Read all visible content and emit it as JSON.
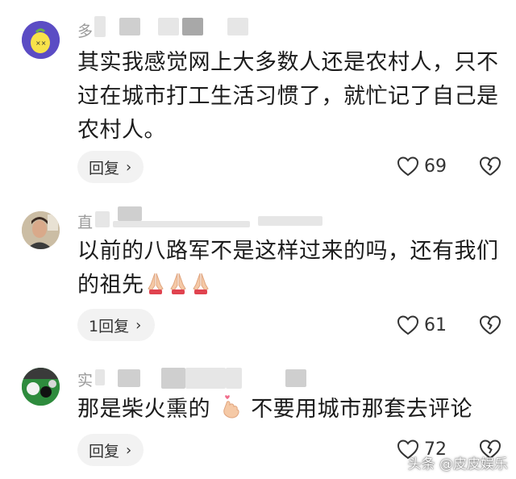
{
  "comments": [
    {
      "username": "多",
      "text": "其实我感觉网上大多数人还是农村人，只不过在城市打工生活习惯了，就忙记了自己是农村人。",
      "reply_label": "回复",
      "likes": "69"
    },
    {
      "username": "直",
      "text_main": "以前的八路军不是这样过来的吗，还有我们的祖先",
      "emoji": "folded-hands-icon",
      "reply_label": "1回复",
      "likes": "61"
    },
    {
      "username": "实",
      "text_before": "那是柴火熏的",
      "emoji": "finger-heart-icon",
      "text_after": "不要用城市那套去评论",
      "reply_label": "回复",
      "likes": "72"
    }
  ],
  "watermark": "头条 @皮皮娱乐",
  "colors": {
    "reply_bg": "#f2f2f2",
    "username": "#9a9a9a",
    "text": "#1c1c1c",
    "emoji_hand": "#f5c9a6",
    "heart_pink": "#f06b8a"
  }
}
